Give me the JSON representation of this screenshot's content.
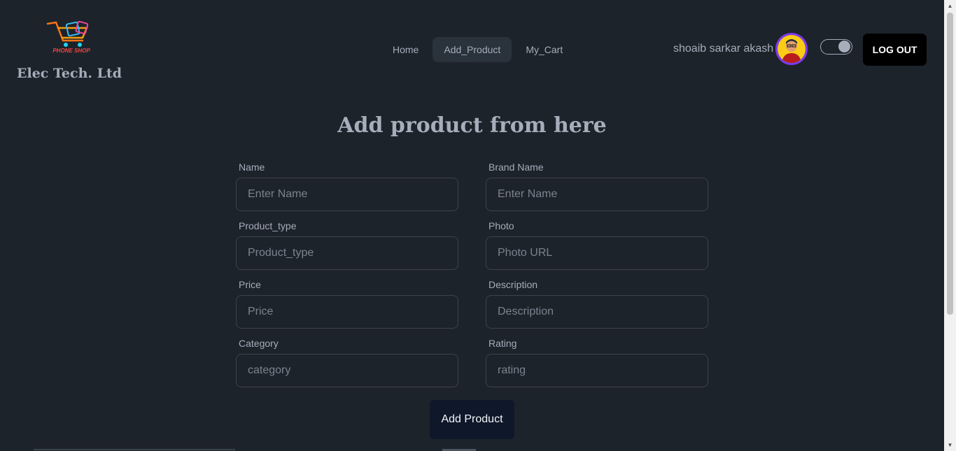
{
  "header": {
    "logo_text": "PHONE SHOP",
    "brand_name": "Elec Tech. Ltd",
    "nav": [
      {
        "label": "Home"
      },
      {
        "label": "Add_Product"
      },
      {
        "label": "My_Cart"
      }
    ],
    "user_name": "shoaib sarkar akash",
    "logout_label": "LOG OUT"
  },
  "form": {
    "title": "Add product from here",
    "fields": {
      "name": {
        "label": "Name",
        "placeholder": "Enter Name",
        "value": ""
      },
      "brand": {
        "label": "Brand Name",
        "placeholder": "Enter Name",
        "value": ""
      },
      "type": {
        "label": "Product_type",
        "placeholder": "Product_type",
        "value": ""
      },
      "photo": {
        "label": "Photo",
        "placeholder": "Photo URL",
        "value": ""
      },
      "price": {
        "label": "Price",
        "placeholder": "Price",
        "value": ""
      },
      "description": {
        "label": "Description",
        "placeholder": "Description",
        "value": ""
      },
      "category": {
        "label": "Category",
        "placeholder": "category",
        "value": ""
      },
      "rating": {
        "label": "Rating",
        "placeholder": "rating",
        "value": ""
      }
    },
    "submit_label": "Add Product"
  },
  "colors": {
    "background": "#1d232a",
    "text": "#a6adbb",
    "active_nav": "#2a323c",
    "logout_bg": "#000000",
    "submit_bg": "#0f172a",
    "avatar_ring": "#7c3aed"
  }
}
